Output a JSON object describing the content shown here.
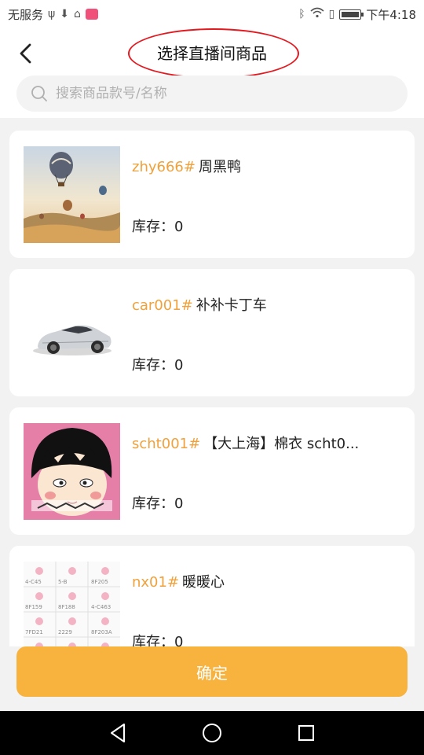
{
  "status_bar": {
    "carrier": "无服务",
    "time": "下午4:18"
  },
  "header": {
    "title": "选择直播间商品",
    "back_icon": "chevron-left-icon"
  },
  "search": {
    "placeholder": "搜索商品款号/名称",
    "value": ""
  },
  "products": [
    {
      "code": "zhy666#",
      "name": "周黑鸭",
      "stock_label": "库存：",
      "stock": "0",
      "image": "hot-air-balloons"
    },
    {
      "code": "car001#",
      "name": "补补卡丁车",
      "stock_label": "库存：",
      "stock": "0",
      "image": "silver-sports-car"
    },
    {
      "code": "scht001#",
      "name": "【大上海】棉衣  scht0...",
      "stock_label": "库存：",
      "stock": "0",
      "image": "cartoon-girl"
    },
    {
      "code": "nx01#",
      "name": "暖暖心",
      "stock_label": "库存：",
      "stock": "0",
      "image": "label-sheet"
    }
  ],
  "confirm_label": "确定",
  "colors": {
    "accent": "#f7b33e",
    "code_text": "#f0a13b",
    "annotation_circle": "#e4191f"
  }
}
